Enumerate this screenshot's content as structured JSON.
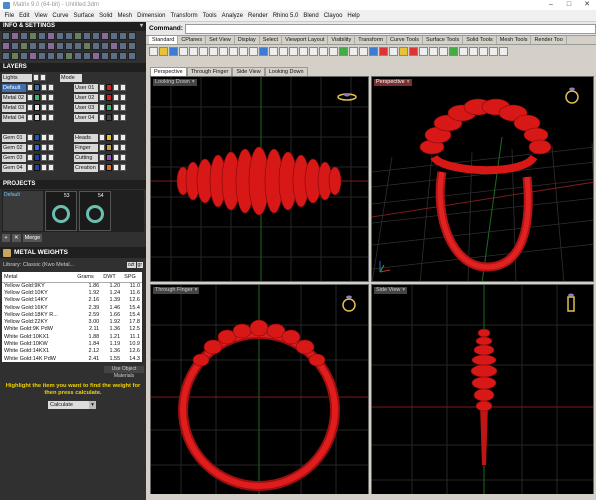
{
  "window": {
    "title": "Matrix 9.0 (64-bit) - Untitled.3dm",
    "minimize": "–",
    "maximize": "□",
    "close": "✕"
  },
  "menu": [
    "File",
    "Edit",
    "View",
    "Curve",
    "Surface",
    "Solid",
    "Mesh",
    "Dimension",
    "Transform",
    "Tools",
    "Analyze",
    "Render",
    "Rhino 5.0",
    "Blend",
    "Clayoo",
    "Help"
  ],
  "left": {
    "info_title": "INFO & SETTINGS",
    "layers_title": "LAYERS",
    "lights": "Lights",
    "mode_label": "Mode",
    "layers_left": [
      {
        "name": "Default",
        "color": "#3b6fb6",
        "selected": true
      },
      {
        "name": "Metal 02",
        "color": "#3cb371"
      },
      {
        "name": "Metal 03",
        "color": "#e7e7e7"
      },
      {
        "name": "Metal 04",
        "color": "#dddddd"
      },
      {
        "name": "",
        "color": "#303030"
      },
      {
        "name": "Gem 01",
        "color": "#1b5ab8"
      },
      {
        "name": "Gem 02",
        "color": "#2f6fd1"
      },
      {
        "name": "Gem 03",
        "color": "#1e3fa8"
      },
      {
        "name": "Gem 04",
        "color": "#2444aa"
      }
    ],
    "layers_right": [
      {
        "name": "User 01",
        "color": "#e02020"
      },
      {
        "name": "User 02",
        "color": "#e02020"
      },
      {
        "name": "User 03",
        "color": "#3cb371"
      },
      {
        "name": "User 04",
        "color": "#4a4a4a"
      },
      {
        "name": "",
        "color": "#303030"
      },
      {
        "name": "Heads",
        "color": "#e6c229"
      },
      {
        "name": "Finger",
        "color": "#c8a24a"
      },
      {
        "name": "Cutting",
        "color": "#8a5ab8"
      },
      {
        "name": "Creation",
        "color": "#e07020"
      }
    ],
    "projects_title": "PROJECTS",
    "project_default": "Default",
    "project_thumbs": [
      "53",
      "54"
    ],
    "proj_buttons": [
      "+",
      "✕",
      "Merge"
    ],
    "metal_weights_title": "METAL WEIGHTS",
    "library_label": "Library: Classic (Kwo Metal...",
    "library_sel": [
      "ozt",
      "gr"
    ],
    "table_headers": [
      "Metal",
      "Grams",
      "DWT",
      "SPG"
    ],
    "table_rows": [
      [
        "Yellow Gold:9KY",
        "1.86",
        "1.20",
        "11.0"
      ],
      [
        "Yellow Gold:10KY",
        "1.92",
        "1.24",
        "11.6"
      ],
      [
        "Yellow Gold:14KY",
        "2.16",
        "1.39",
        "12.6"
      ],
      [
        "Yellow Gold:16KY",
        "2.39",
        "1.46",
        "15.4"
      ],
      [
        "Yellow Gold:18KY R...",
        "2.59",
        "1.66",
        "15.4"
      ],
      [
        "Yellow Gold:22KY",
        "3.00",
        "1.92",
        "17.8"
      ],
      [
        "White Gold:9K PdW",
        "2.11",
        "1.36",
        "12.5"
      ],
      [
        "White Gold:10KX1",
        "1.88",
        "1.21",
        "11.1"
      ],
      [
        "White Gold:10KW",
        "1.84",
        "1.19",
        "10.9"
      ],
      [
        "White Gold:14KX1",
        "2.12",
        "1.36",
        "12.6"
      ],
      [
        "White Gold:14K PdW",
        "2.41",
        "1.55",
        "14.3"
      ]
    ],
    "use_object": "Use Object Materials",
    "note": "Highlight the item you want to find the weight for then press calculate.",
    "calc_label": "Calculate"
  },
  "right": {
    "command_label": "Command:",
    "toolbar_tabs": [
      "Standard",
      "CPlanes",
      "Set View",
      "Display",
      "Select",
      "Viewport Layout",
      "Visibility",
      "Transform",
      "Curve Tools",
      "Surface Tools",
      "Solid Tools",
      "Mesh Tools",
      "Render Too"
    ],
    "viewport_tabs": [
      "Perspective",
      "Through Finger",
      "Side View",
      "Looking Down"
    ],
    "viewports": {
      "top_left": "Looking Down",
      "top_right": "Perspective",
      "bottom_left": "Through Finger",
      "bottom_right": "Side View"
    },
    "colors": {
      "ring": "#e01c1c",
      "ring_dark": "#8a0c0c",
      "grid": "#2e2e2e",
      "axis_x": "#8a1c1c",
      "axis_y": "#1c6a1c",
      "active": "#7b3131",
      "gold": "#e2c050"
    }
  }
}
